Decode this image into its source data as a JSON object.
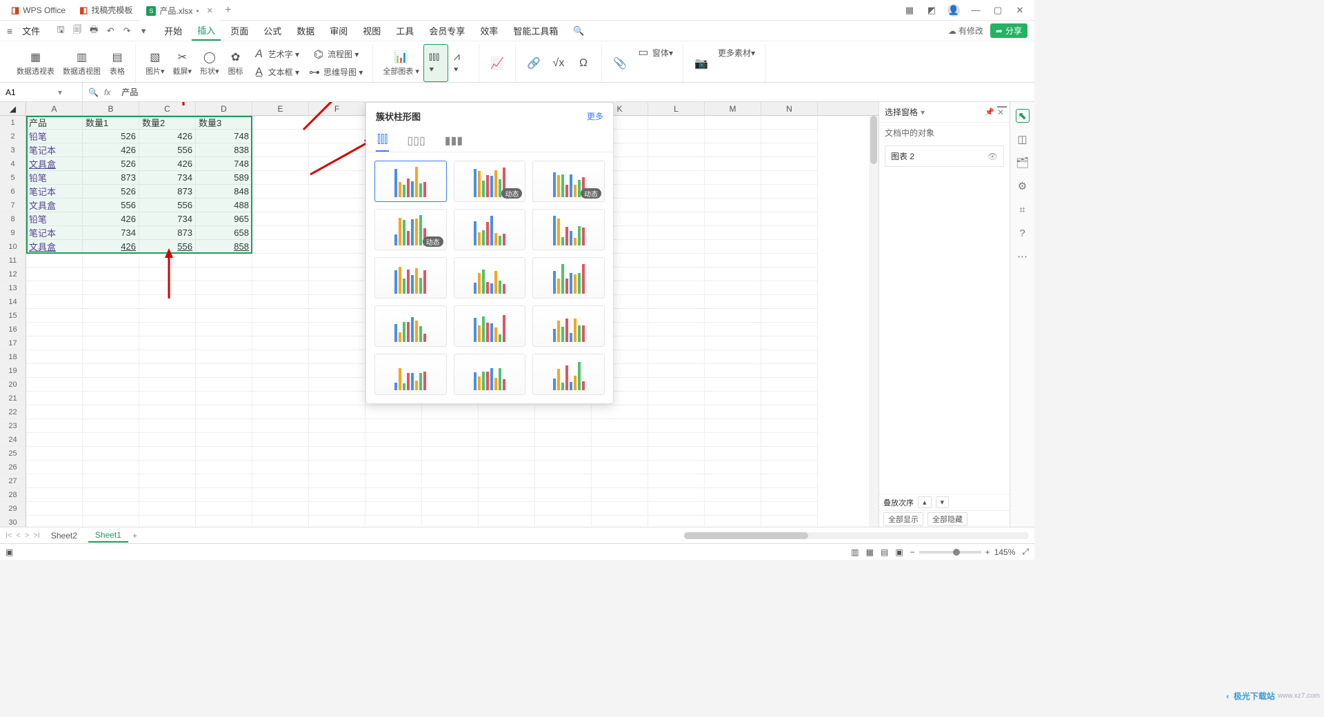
{
  "titlebar": {
    "app_name": "WPS Office",
    "tabs": [
      {
        "label": "找稿壳模板",
        "icon": "doc"
      },
      {
        "label": "产品.xlsx",
        "icon": "sheet",
        "active": true,
        "dirty": true
      }
    ],
    "add": "+"
  },
  "menubar": {
    "file": "文件",
    "items": [
      "开始",
      "插入",
      "页面",
      "公式",
      "数据",
      "审阅",
      "视图",
      "工具",
      "会员专享",
      "效率",
      "智能工具箱"
    ],
    "active_index": 1,
    "modified": "有修改",
    "share": "分享"
  },
  "ribbon": {
    "groups": {
      "pivot1": "数据透视表",
      "pivot2": "数据透视图",
      "table": "表格",
      "picture": "图片",
      "screenshot": "截屏",
      "shapes": "形状",
      "icons": "图标",
      "wordart": "艺术字",
      "textbox": "文本框",
      "flowchart": "流程图",
      "mindmap": "思维导图",
      "allcharts": "全部图表",
      "more_assets": "更多素材",
      "form": "窗体"
    }
  },
  "namebox": {
    "cell": "A1"
  },
  "formula_bar": {
    "value": "产品"
  },
  "grid": {
    "cols": [
      "A",
      "B",
      "C",
      "D",
      "E",
      "F",
      "G",
      "H",
      "I",
      "J",
      "K",
      "L",
      "M",
      "N"
    ],
    "row_count": 30,
    "headers": [
      "产品",
      "数量1",
      "数量2",
      "数量3"
    ],
    "rows": [
      [
        "铅笔",
        526,
        426,
        748
      ],
      [
        "笔记本",
        426,
        556,
        838
      ],
      [
        "文具盒",
        526,
        426,
        748
      ],
      [
        "铅笔",
        873,
        734,
        589
      ],
      [
        "笔记本",
        526,
        873,
        848
      ],
      [
        "文具盒",
        556,
        556,
        488
      ],
      [
        "铅笔",
        426,
        734,
        965
      ],
      [
        "笔记本",
        734,
        873,
        658
      ],
      [
        "文具盒",
        426,
        556,
        858
      ]
    ],
    "selection": {
      "r1": 1,
      "c1": 1,
      "r2": 10,
      "c2": 4
    }
  },
  "chart_popup": {
    "title": "簇状柱形图",
    "more": "更多",
    "dynamic_tag": "动态",
    "thumb_count": 15
  },
  "selection_pane": {
    "title": "选择窗格",
    "subtitle": "文档中的对象",
    "item": "图表 2",
    "stack_order": "叠放次序",
    "show_all": "全部显示",
    "hide_all": "全部隐藏"
  },
  "sheets": {
    "tabs": [
      "Sheet2",
      "Sheet1"
    ],
    "active_index": 1,
    "add": "+"
  },
  "statusbar": {
    "zoom": "145%"
  },
  "watermark": {
    "brand": "极光下载站",
    "url": "www.xz7.com"
  }
}
